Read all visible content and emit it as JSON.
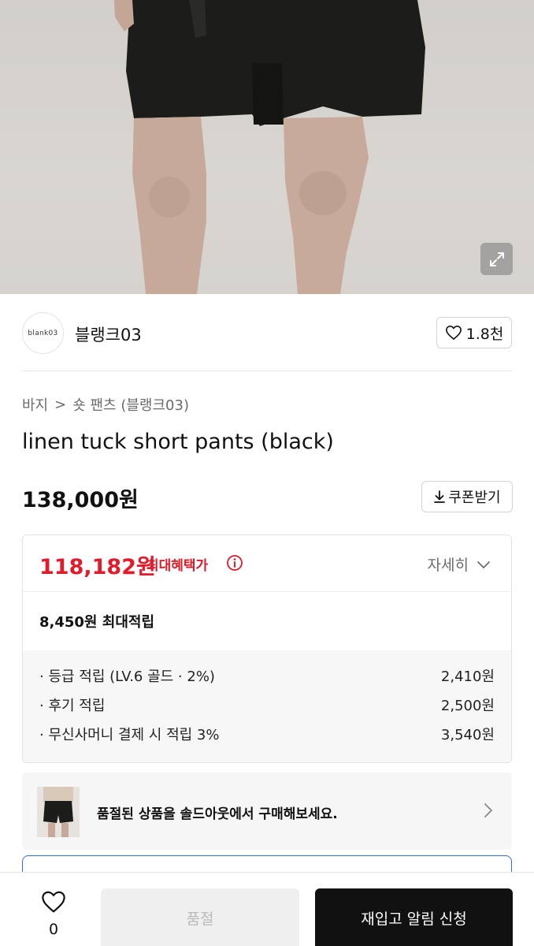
{
  "hero": {
    "image": "product-photo-black-shorts",
    "expand_icon": "expand-arrows-icon"
  },
  "brand": {
    "logo_text": "blank03",
    "name": "블랭크03",
    "like_count": "1.8천",
    "like_icon": "heart-outline-icon"
  },
  "breadcrumb": {
    "category": "바지",
    "separator": ">",
    "subcategory": "숏 팬츠 (블랭크03)"
  },
  "product": {
    "title": "linen tuck short pants (black)",
    "price": "138,000원",
    "coupon_label": "쿠폰받기",
    "coupon_icon": "download-arrow-icon"
  },
  "benefit": {
    "max_price": "118,182원",
    "max_label": "최대혜택가",
    "info_icon": "info-circle-icon",
    "detail_label": "자세히",
    "detail_icon": "chevron-down-icon",
    "points_total": "8,450원 최대적립",
    "point_lines": [
      {
        "label": "· 등급 적립 (LV.6 골드 · 2%)",
        "value": "2,410원"
      },
      {
        "label": "· 후기 적립",
        "value": "2,500원"
      },
      {
        "label": "· 무신사머니 결제 시 적립 3%",
        "value": "3,540원"
      }
    ]
  },
  "soldout_banner": {
    "text": "품절된 상품을 솔드아웃에서 구매해보세요.",
    "chevron_icon": "chevron-right-icon"
  },
  "bottom_bar": {
    "wish_count": "0",
    "wish_icon": "heart-outline-icon",
    "soldout_label": "품절",
    "restock_label": "재입고 알림 신청"
  },
  "colors": {
    "accent_red": "#e01b2a",
    "primary_black": "#111111",
    "disabled_gray": "#efefef",
    "focus_blue": "#2f6de1"
  }
}
